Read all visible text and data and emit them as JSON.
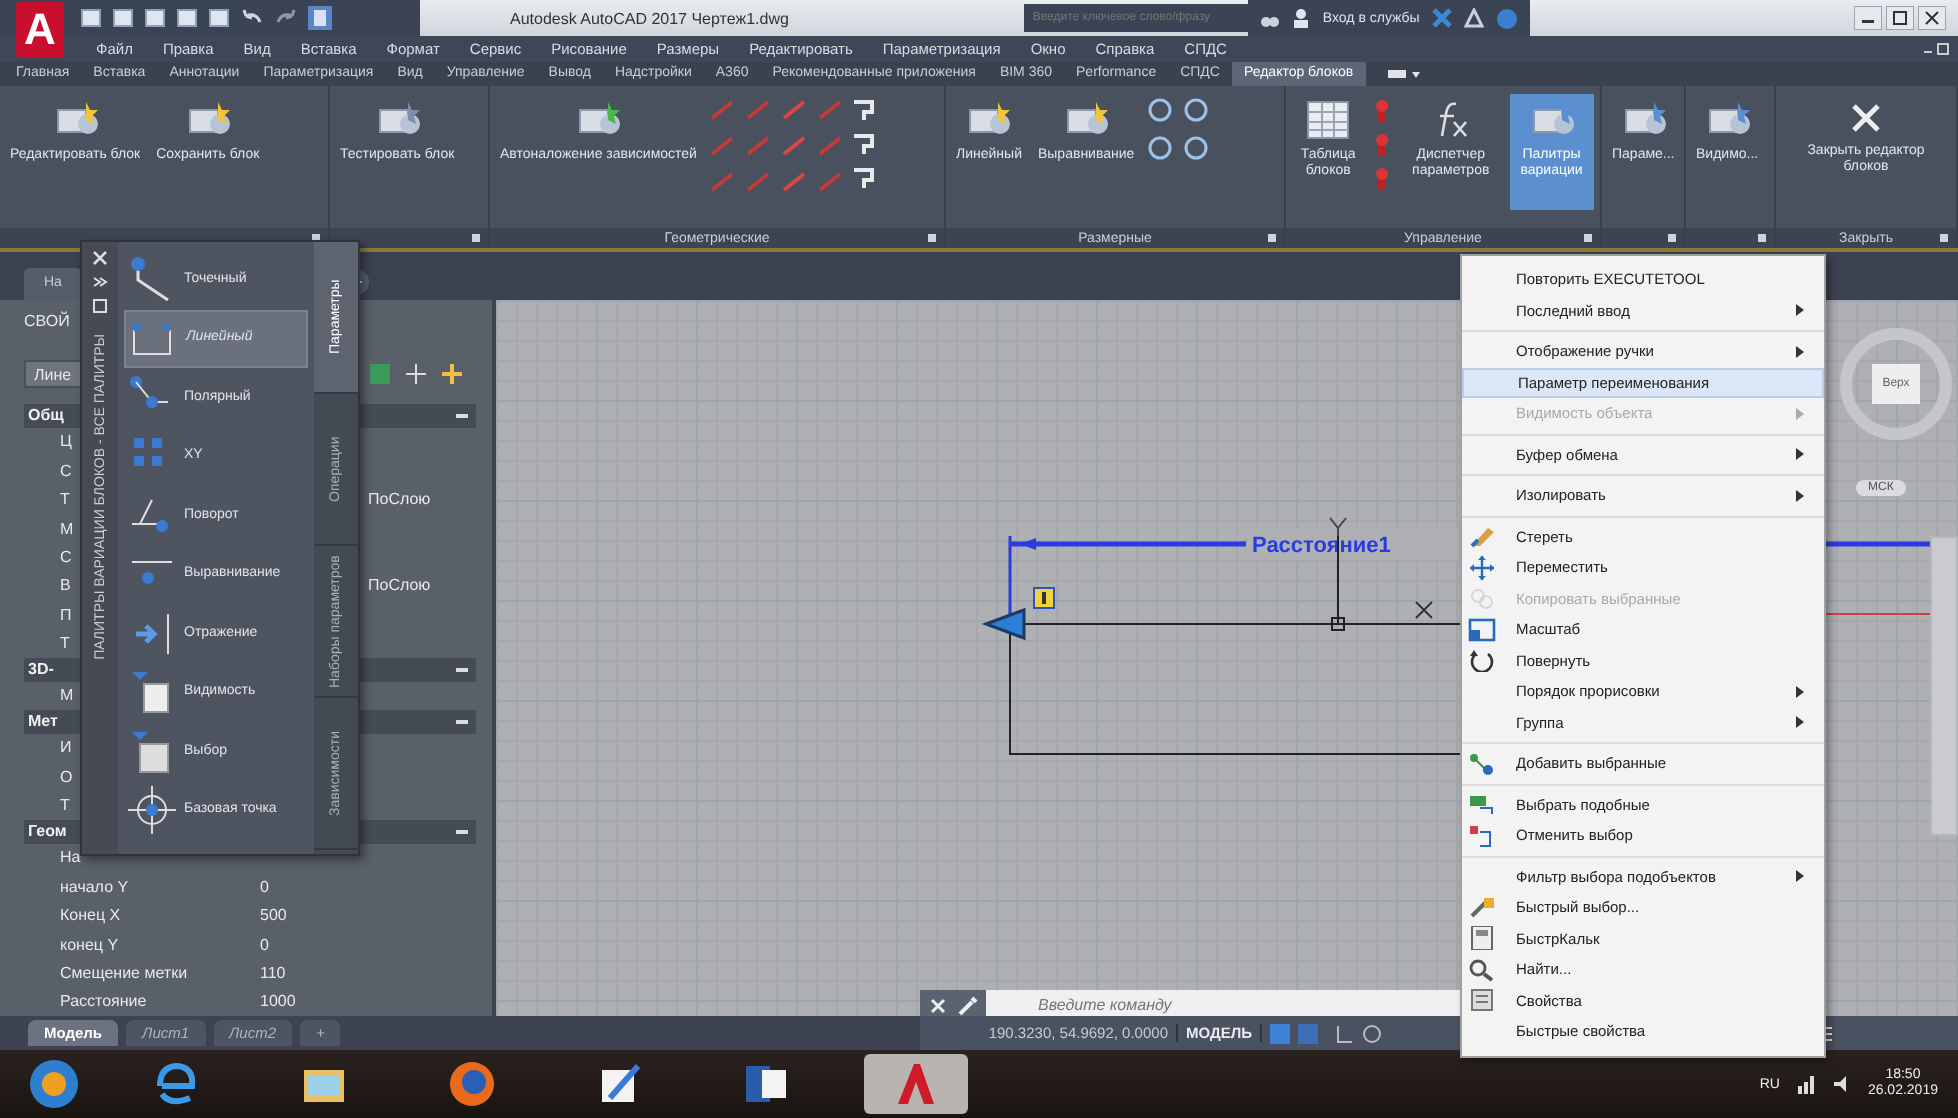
{
  "title_bar": {
    "app": "Autodesk AutoCAD 2017",
    "file": "Чертеж1.dwg",
    "search_placeholder": "Введите ключевое слово/фразу",
    "sign_in": "Вход в службы"
  },
  "logo": "A",
  "menu_bar": [
    "Файл",
    "Правка",
    "Вид",
    "Вставка",
    "Формат",
    "Сервис",
    "Рисование",
    "Размеры",
    "Редактировать",
    "Параметризация",
    "Окно",
    "Справка",
    "СПДС"
  ],
  "ribbon_tabs": [
    {
      "label": "Главная",
      "selected": false
    },
    {
      "label": "Вставка",
      "selected": false
    },
    {
      "label": "Аннотации",
      "selected": false
    },
    {
      "label": "Параметризация",
      "selected": false
    },
    {
      "label": "Вид",
      "selected": false
    },
    {
      "label": "Управление",
      "selected": false
    },
    {
      "label": "Вывод",
      "selected": false
    },
    {
      "label": "Надстройки",
      "selected": false
    },
    {
      "label": "A360",
      "selected": false
    },
    {
      "label": "Рекомендованные приложения",
      "selected": false
    },
    {
      "label": "BIM 360",
      "selected": false
    },
    {
      "label": "Performance",
      "selected": false
    },
    {
      "label": "СПДС",
      "selected": false
    },
    {
      "label": "Редактор блоков",
      "selected": true
    }
  ],
  "ribbon_panels": [
    {
      "kind": "plain",
      "buttons": [
        {
          "label": "Редактировать блок",
          "selected": false
        },
        {
          "label": "Сохранить блок",
          "selected": false
        }
      ]
    },
    {
      "kind": "plain",
      "buttons": [
        {
          "label": "Тестировать блок",
          "selected": false
        }
      ]
    },
    {
      "kind": "geometric",
      "title": "Геометрические",
      "buttons": [
        {
          "label": "Автоналожение зависимостей",
          "selected": false
        }
      ]
    },
    {
      "kind": "dimensional",
      "title": "Размерные",
      "buttons": [
        {
          "label": "Линейный",
          "selected": false
        },
        {
          "label": "Выравнивание",
          "selected": false
        }
      ]
    },
    {
      "kind": "manage",
      "title": "Управление",
      "buttons": [
        {
          "label": "Таблица блоков",
          "selected": false
        },
        {
          "label": "Диспетчер параметров",
          "selected": false
        },
        {
          "label": "Палитры вариации",
          "selected": true
        }
      ]
    },
    {
      "kind": "plain",
      "buttons": [
        {
          "label": "Параме...",
          "selected": false
        }
      ]
    },
    {
      "kind": "plain",
      "buttons": [
        {
          "label": "Видимо...",
          "selected": false
        }
      ]
    },
    {
      "kind": "plain",
      "title": "Закрыть",
      "buttons": [
        {
          "label": "Закрыть редактор блоков",
          "selected": false
        }
      ]
    }
  ],
  "document_tab": "На",
  "properties": {
    "title": "СВОЙ",
    "selector": "Лине",
    "sections": [
      {
        "title": "Общ",
        "rows": [
          {
            "name": "Ц"
          },
          {
            "name": "С"
          },
          {
            "name": "Т",
            "value": "ПоСлою"
          },
          {
            "name": "М"
          },
          {
            "name": "С"
          },
          {
            "name": "В",
            "value": "ПоСлою"
          },
          {
            "name": "П"
          },
          {
            "name": "Т"
          }
        ]
      },
      {
        "title": "3D-",
        "rows": [
          {
            "name": "М"
          }
        ]
      },
      {
        "title": "Мет",
        "rows": [
          {
            "name": "И"
          },
          {
            "name": "О"
          },
          {
            "name": "Т"
          }
        ]
      },
      {
        "title": "Геом",
        "rows": [
          {
            "name": "На"
          },
          {
            "name": "начало Y",
            "value": "0"
          },
          {
            "name": "Конец X",
            "value": "500"
          },
          {
            "name": "конец Y",
            "value": "0"
          },
          {
            "name": "Смещение метки",
            "value": "110"
          },
          {
            "name": "Расстояние",
            "value": "1000"
          }
        ]
      }
    ]
  },
  "palette": {
    "title": "ПАЛИТРЫ ВАРИАЦИИ БЛОКОВ - ВСЕ ПАЛИТРЫ",
    "tabs": [
      {
        "label": "Параметры",
        "selected": true
      },
      {
        "label": "Операции",
        "selected": false
      },
      {
        "label": "Наборы параметров",
        "selected": false
      },
      {
        "label": "Зависимости",
        "selected": false
      }
    ],
    "items": [
      {
        "label": "Точечный",
        "selected": false
      },
      {
        "label": "Линейный",
        "selected": true
      },
      {
        "label": "Полярный",
        "selected": false
      },
      {
        "label": "XY",
        "selected": false
      },
      {
        "label": "Поворот",
        "selected": false
      },
      {
        "label": "Выравнивание",
        "selected": false
      },
      {
        "label": "Отражение",
        "selected": false
      },
      {
        "label": "Видимость",
        "selected": false
      },
      {
        "label": "Выбор",
        "selected": false
      },
      {
        "label": "Базовая точка",
        "selected": false
      }
    ]
  },
  "drawing": {
    "dimension_label": "Расстояние1",
    "viewcube_face": "Верх",
    "ucs_label": "МСК"
  },
  "command_line": {
    "placeholder": "Введите команду"
  },
  "layout_tabs": [
    {
      "label": "Модель",
      "selected": true
    },
    {
      "label": "Лист1",
      "selected": false
    },
    {
      "label": "Лист2",
      "selected": false
    },
    {
      "label": "+",
      "selected": false
    }
  ],
  "status_bar": {
    "coordinates": "190.3230, 54.9692, 0.0000",
    "space": "МОДЕЛЬ"
  },
  "context_menu": {
    "groups": [
      {
        "items": [
          {
            "label": "Повторить EXECUTETOOL",
            "submenu": false,
            "disabled": false,
            "selected": false
          },
          {
            "label": "Последний ввод",
            "submenu": true,
            "disabled": false,
            "selected": false
          }
        ]
      },
      {
        "items": [
          {
            "label": "Отображение ручки",
            "submenu": true,
            "disabled": false,
            "selected": false
          },
          {
            "label": "Параметр переименования",
            "submenu": false,
            "disabled": false,
            "selected": true
          },
          {
            "label": "Видимость объекта",
            "submenu": true,
            "disabled": true,
            "selected": false
          }
        ]
      },
      {
        "items": [
          {
            "label": "Буфер обмена",
            "submenu": true,
            "disabled": false,
            "selected": false
          }
        ]
      },
      {
        "items": [
          {
            "label": "Изолировать",
            "submenu": true,
            "disabled": false,
            "selected": false
          }
        ]
      },
      {
        "items": [
          {
            "label": "Стереть",
            "submenu": false,
            "disabled": false,
            "selected": false
          },
          {
            "label": "Переместить",
            "submenu": false,
            "disabled": false,
            "selected": false
          },
          {
            "label": "Копировать выбранные",
            "submenu": false,
            "disabled": true,
            "selected": false
          },
          {
            "label": "Масштаб",
            "submenu": false,
            "disabled": false,
            "selected": false
          },
          {
            "label": "Повернуть",
            "submenu": false,
            "disabled": false,
            "selected": false
          },
          {
            "label": "Порядок прорисовки",
            "submenu": true,
            "disabled": false,
            "selected": false
          },
          {
            "label": "Группа",
            "submenu": true,
            "disabled": false,
            "selected": false
          }
        ]
      },
      {
        "items": [
          {
            "label": "Добавить выбранные",
            "submenu": false,
            "disabled": false,
            "selected": false
          }
        ]
      },
      {
        "items": [
          {
            "label": "Выбрать подобные",
            "submenu": false,
            "disabled": false,
            "selected": false
          },
          {
            "label": "Отменить выбор",
            "submenu": false,
            "disabled": false,
            "selected": false
          }
        ]
      },
      {
        "items": [
          {
            "label": "Фильтр выбора подобъектов",
            "submenu": true,
            "disabled": false,
            "selected": false
          },
          {
            "label": "Быстрый выбор...",
            "submenu": false,
            "disabled": false,
            "selected": false
          },
          {
            "label": "БыстрКальк",
            "submenu": false,
            "disabled": false,
            "selected": false
          },
          {
            "label": "Найти...",
            "submenu": false,
            "disabled": false,
            "selected": false
          },
          {
            "label": "Свойства",
            "submenu": false,
            "disabled": false,
            "selected": false
          },
          {
            "label": "Быстрые свойства",
            "submenu": false,
            "disabled": false,
            "selected": false
          }
        ]
      }
    ]
  },
  "taskbar": {
    "apps": [
      {
        "selected": false
      },
      {
        "selected": false
      },
      {
        "selected": false
      },
      {
        "selected": false
      },
      {
        "selected": false
      },
      {
        "selected": true
      }
    ],
    "language": "RU",
    "time": "18:50",
    "date": "26.02.2019"
  }
}
